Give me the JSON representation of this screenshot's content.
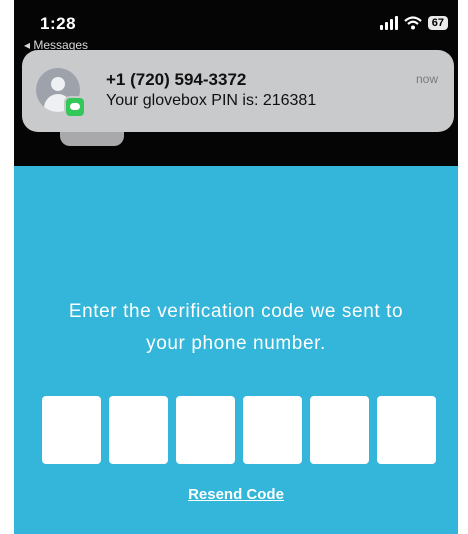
{
  "status_bar": {
    "time": "1:28",
    "back_label": "◂ Messages",
    "battery": "67"
  },
  "notification": {
    "sender": "+1 (720) 594-3372",
    "message": "Your glovebox PIN is: 216381",
    "time": "now",
    "app_icon": "messages-icon"
  },
  "verification": {
    "prompt_line1": "Enter the verification code we sent to",
    "prompt_line2": "your phone number.",
    "code_digits": [
      "",
      "",
      "",
      "",
      "",
      ""
    ],
    "resend_label": "Resend Code"
  },
  "colors": {
    "screen_background": "#33b6d9",
    "top_background": "#050505",
    "notification_background": "#c9cacc",
    "messages_green": "#34c759"
  }
}
